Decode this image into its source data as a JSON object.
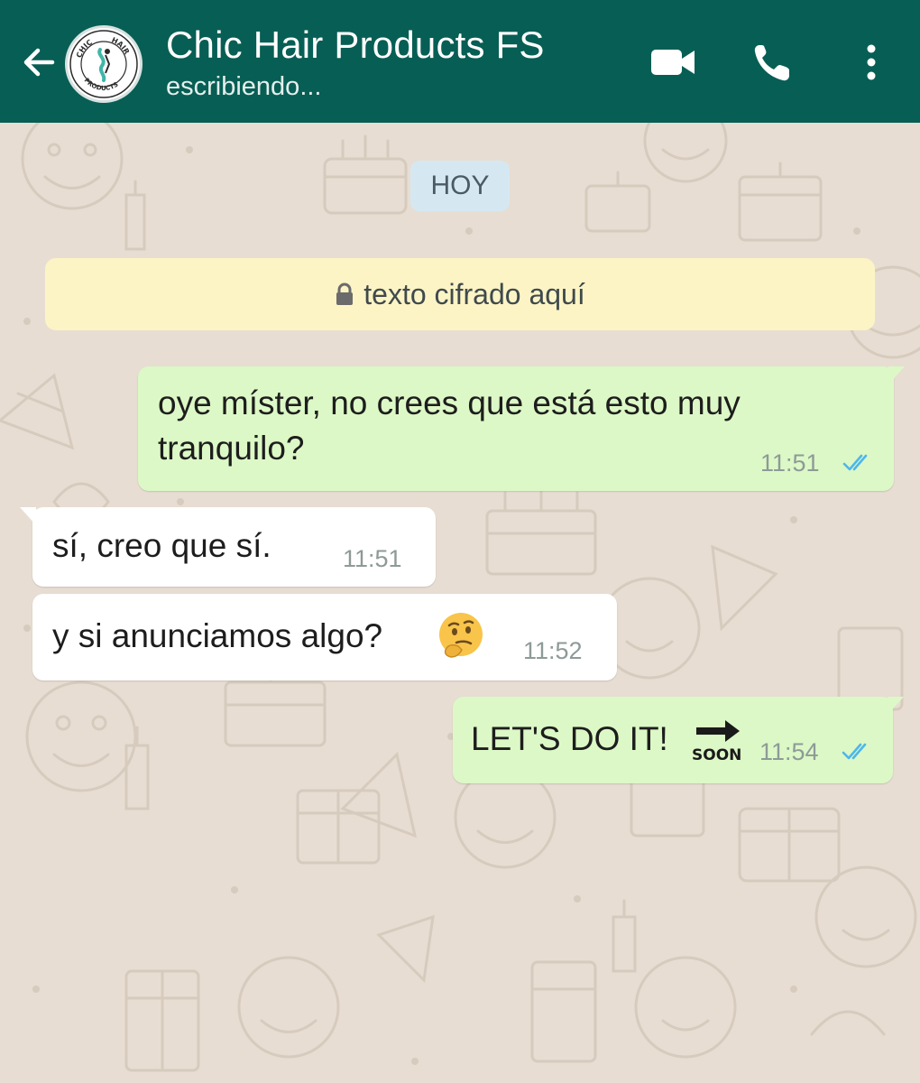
{
  "header": {
    "title": "Chic Hair Products FS",
    "status": "escribiendo...",
    "avatar_logo": [
      "CHIC",
      "HAIR",
      "PRODUCTS"
    ],
    "background": "#075e54"
  },
  "chat": {
    "date_label": "HOY",
    "encryption_notice": "texto cifrado aquí",
    "messages": [
      {
        "direction": "outgoing",
        "lines": [
          "oye míster, no crees que está esto muy",
          "tranquilo?"
        ],
        "time": "11:51",
        "status": "read"
      },
      {
        "direction": "incoming",
        "text": "sí, creo que sí.",
        "time": "11:51"
      },
      {
        "direction": "incoming",
        "text": "y si anunciamos algo?",
        "emoji": "thinking-face",
        "time": "11:52"
      },
      {
        "direction": "outgoing",
        "text": "LET'S DO IT!",
        "emoji": "soon-arrow",
        "emoji_label": "SOON",
        "time": "11:54",
        "status": "read"
      }
    ]
  },
  "colors": {
    "outgoing_bubble": "#dcf8c6",
    "incoming_bubble": "#ffffff",
    "read_ticks": "#4fb6ec"
  }
}
